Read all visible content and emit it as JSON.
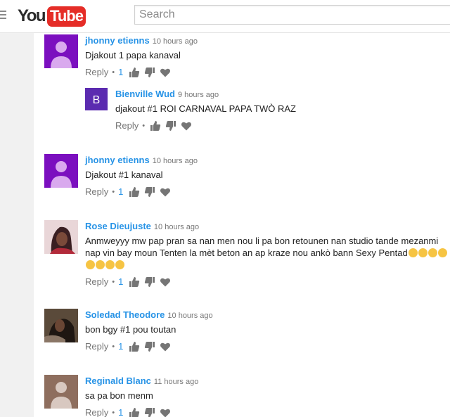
{
  "header": {
    "logo_you": "You",
    "logo_tube": "Tube",
    "search_placeholder": "Search"
  },
  "comments": [
    {
      "author": "jhonny etienns",
      "time": "10 hours ago",
      "text": "Djakout 1 papa kanaval",
      "reply_label": "Reply",
      "likes": "1",
      "avatar": "default-purple",
      "replies": [
        {
          "author": "Bienville Wud",
          "time": "9 hours ago",
          "text": "djakout #1 ROI CARNAVAL  PAPA TWÒ RAZ",
          "reply_label": "Reply",
          "avatar_letter": "B"
        }
      ]
    },
    {
      "author": "jhonny etienns",
      "time": "10 hours ago",
      "text": "Djakout #1 kanaval",
      "reply_label": "Reply",
      "likes": "1",
      "avatar": "default-purple"
    },
    {
      "author": "Rose Dieujuste",
      "time": "10 hours ago",
      "text_line1": "Anmweyyy mw pap pran sa nan men nou li pa bon retounen nan studio tande mezanmi",
      "text_line2": "nap vin bay moun Tenten la mèt beton an ap kraze nou ankò bann Sexy Pentad",
      "reply_label": "Reply",
      "likes": "1",
      "avatar": "photo"
    },
    {
      "author": "Soledad Theodore",
      "time": "10 hours ago",
      "text": "bon bgy #1 pou toutan",
      "reply_label": "Reply",
      "likes": "1",
      "avatar": "photo"
    },
    {
      "author": "Reginald Blanc",
      "time": "11 hours ago",
      "text": "sa pa bon menm",
      "reply_label": "Reply",
      "likes": "1",
      "avatar": "default-brown"
    }
  ],
  "colors": {
    "author": "#2793e6",
    "logo_red": "#e52d27",
    "avatar_purple": "#7b0fbf",
    "avatar_brown": "#8e6e5e",
    "reply_avatar": "#5b2bb0"
  },
  "icons": [
    "menu-icon",
    "thumbs-up-icon",
    "thumbs-down-icon",
    "heart-icon",
    "laughing-emoji-icon"
  ]
}
